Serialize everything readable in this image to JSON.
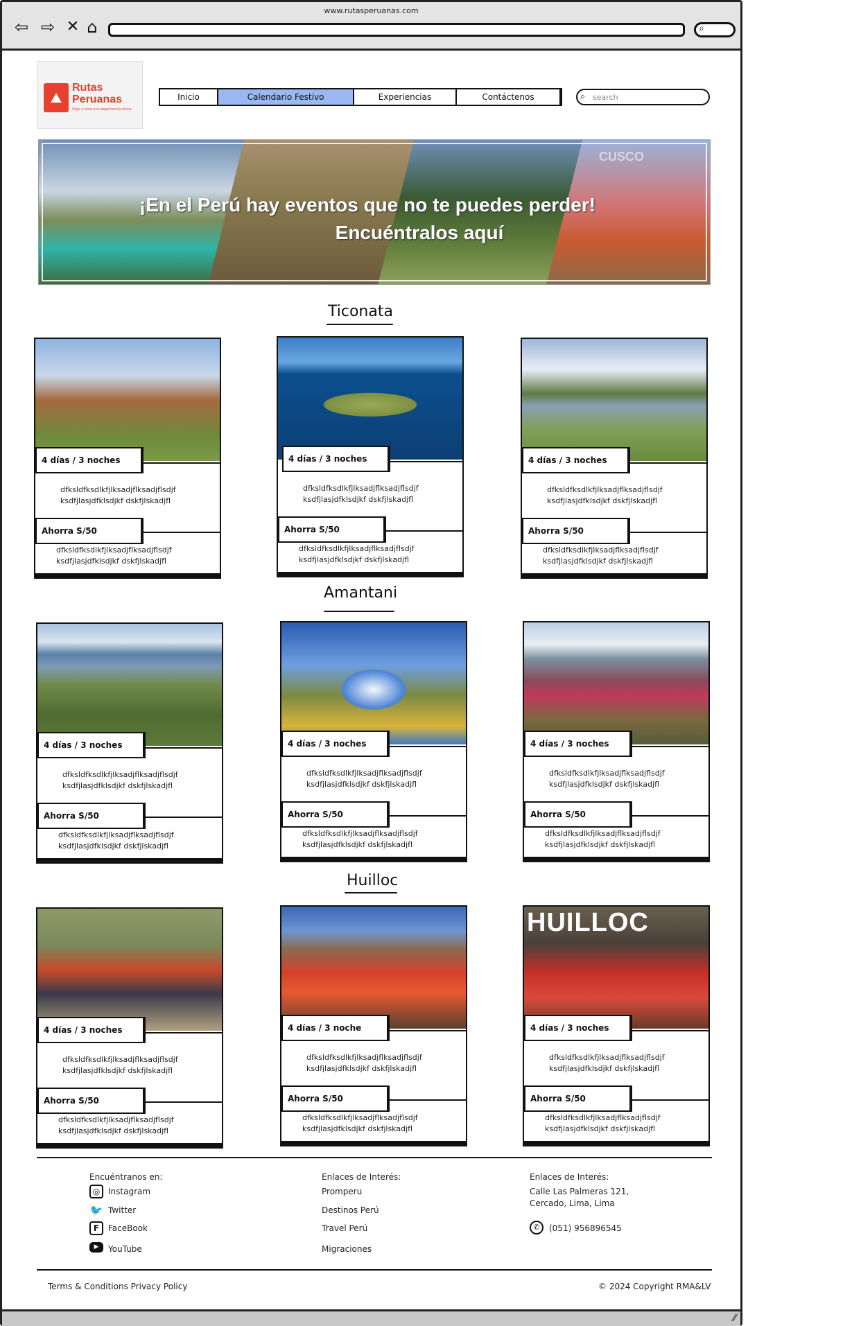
{
  "browser": {
    "url": "www.rutasperuanas.com",
    "back_icon": "arrow-left-icon",
    "forward_icon": "arrow-right-icon",
    "close_icon": "x-icon",
    "home_icon": "home-icon"
  },
  "brand": {
    "line1": "Rutas",
    "line2": "Peruanas",
    "tagline": "Viaja y vive una experiencia única",
    "color": "#e8402e"
  },
  "nav": {
    "items": [
      {
        "label": "Inicio"
      },
      {
        "label": "Calendario Festivo"
      },
      {
        "label": "Experiencias"
      },
      {
        "label": "Contáctenos"
      }
    ],
    "active_color": "#9ab9f2",
    "search_placeholder": "search"
  },
  "hero": {
    "line1": "¡En el Perú hay eventos que no te puedes perder!",
    "line2": "Encuéntralos aquí",
    "watermark": "CUSCO"
  },
  "sections": [
    {
      "title": "Ticonata",
      "cards": [
        {
          "duration": "4 días / 3 noches",
          "desc1": "dfksldfksdlkfjlksadjflksadjflsdjf",
          "desc2": "ksdfjlasjdfklsdjkf dskfjlskadjfl",
          "saving": "Ahorra S/50",
          "desc3": "dfksldfksdlkfjlksadjflksadjflsdjf",
          "desc4": "ksdfjlasjdfklsdjkf dskfjlskadjfl"
        },
        {
          "duration": "4 días / 3 noches",
          "desc1": "dfksldfksdlkfjlksadjflksadjflsdjf",
          "desc2": "ksdfjlasjdfklsdjkf dskfjlskadjfl",
          "saving": "Ahorra S/50",
          "desc3": "dfksldfksdlkfjlksadjflksadjflsdjf",
          "desc4": "ksdfjlasjdfklsdjkf dskfjlskadjfl"
        },
        {
          "duration": "4 días / 3 noches",
          "desc1": "dfksldfksdlkfjlksadjflksadjflsdjf",
          "desc2": "ksdfjlasjdfklsdjkf dskfjlskadjfl",
          "saving": "Ahorra S/50",
          "desc3": "dfksldfksdlkfjlksadjflksadjflsdjf",
          "desc4": "ksdfjlasjdfklsdjkf dskfjlskadjfl"
        }
      ]
    },
    {
      "title": "Amantani",
      "cards": [
        {
          "duration": "4 días / 3 noches",
          "desc1": "dfksldfksdlkfjlksadjflksadjflsdjf",
          "desc2": "ksdfjlasjdfklsdjkf dskfjlskadjfl",
          "saving": "Ahorra S/50",
          "desc3": "dfksldfksdlkfjlksadjflksadjflsdjf",
          "desc4": "ksdfjlasjdfklsdjkf dskfjlskadjfl"
        },
        {
          "duration": "4 días / 3 noches",
          "desc1": "dfksldfksdlkfjlksadjflksadjflsdjf",
          "desc2": "ksdfjlasjdfklsdjkf dskfjlskadjfl",
          "saving": "Ahorra S/50",
          "desc3": "dfksldfksdlkfjlksadjflksadjflsdjf",
          "desc4": "ksdfjlasjdfklsdjkf dskfjlskadjfl"
        },
        {
          "duration": "4 días / 3 noches",
          "desc1": "dfksldfksdlkfjlksadjflksadjflsdjf",
          "desc2": "ksdfjlasjdfklsdjkf dskfjlskadjfl",
          "saving": "Ahorra S/50",
          "desc3": "dfksldfksdlkfjlksadjflksadjflsdjf",
          "desc4": "ksdfjlasjdfklsdjkf dskfjlskadjfl"
        }
      ]
    },
    {
      "title": "Huilloc",
      "cards": [
        {
          "duration": "4 días / 3 noches",
          "desc1": "dfksldfksdlkfjlksadjflksadjflsdjf",
          "desc2": "ksdfjlasjdfklsdjkf dskfjlskadjfl",
          "saving": "Ahorra S/50",
          "desc3": "dfksldfksdlkfjlksadjflksadjflsdjf",
          "desc4": "ksdfjlasjdfklsdjkf dskfjlskadjfl"
        },
        {
          "duration": "4 días / 3 noche",
          "desc1": "dfksldfksdlkfjlksadjflksadjflsdjf",
          "desc2": "ksdfjlasjdfklsdjkf dskfjlskadjfl",
          "saving": "Ahorra S/50",
          "desc3": "dfksldfksdlkfjlksadjflksadjflsdjf",
          "desc4": "ksdfjlasjdfklsdjkf dskfjlskadjfl"
        },
        {
          "duration": "4 días / 3 noches",
          "desc1": "dfksldfksdlkfjlksadjflksadjflsdjf",
          "desc2": "ksdfjlasjdfklsdjkf dskfjlskadjfl",
          "saving": "Ahorra S/50",
          "desc3": "dfksldfksdlkfjlksadjflksadjflsdjf",
          "desc4": "ksdfjlasjdfklsdjkf dskfjlskadjfl",
          "image_text": "HUILLOC"
        }
      ]
    }
  ],
  "footer": {
    "social_title": "Encuéntranos en:",
    "social": [
      {
        "label": "Instagram",
        "icon": "instagram-icon"
      },
      {
        "label": "Twitter",
        "icon": "twitter-icon"
      },
      {
        "label": "FaceBook",
        "icon": "facebook-icon"
      },
      {
        "label": "YouTube",
        "icon": "youtube-icon"
      }
    ],
    "links_title": "Enlaces de Interés:",
    "links": [
      "Promperu",
      "Destinos Perú",
      "Travel Perú",
      "Migraciones"
    ],
    "contact_title": "Enlaces de Interés:",
    "address1": "Calle Las Palmeras 121,",
    "address2": "Cercado, Lima, Lima",
    "phone": "(051) 956896545",
    "terms": "Terms & Conditions Privacy Policy",
    "copyright": "© 2024 Copyright RMA&LV"
  }
}
